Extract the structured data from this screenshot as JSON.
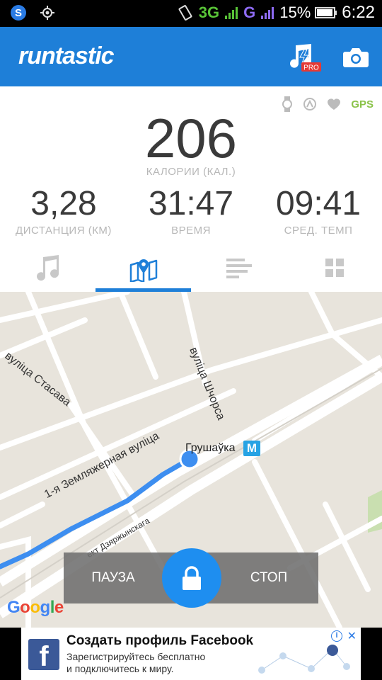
{
  "status_bar": {
    "network": "3G",
    "network_sup": "H",
    "network2": "G",
    "battery": "15%",
    "time": "6:22"
  },
  "app_bar": {
    "logo": "runtastic",
    "pro_badge": "PRO",
    "music_icon": "music-pro-icon",
    "camera_icon": "camera-icon"
  },
  "sensors": {
    "gps_label": "GPS"
  },
  "stats": {
    "calories_value": "206",
    "calories_label": "КАЛОРИИ (КАЛ.)",
    "distance_value": "3,28",
    "distance_label": "ДИСТАНЦИЯ (КМ)",
    "time_value": "31:47",
    "time_label": "ВРЕМЯ",
    "pace_value": "09:41",
    "pace_label": "СРЕД. ТЕМП"
  },
  "tabs": [
    {
      "icon": "music-note-icon",
      "active": false
    },
    {
      "icon": "map-icon",
      "active": true
    },
    {
      "icon": "bars-icon",
      "active": false
    },
    {
      "icon": "grid-icon",
      "active": false
    }
  ],
  "map": {
    "streets": [
      "вуліца Стасава",
      "вуліца Шчорса",
      "1-я Земляжерная вуліца",
      "ект Дзяржынскага"
    ],
    "metro_station": "Грушаўка",
    "metro_badge": "M",
    "attribution": "Google"
  },
  "controls": {
    "pause_label": "ПАУЗА",
    "stop_label": "СТОП",
    "lock_icon": "lock-icon"
  },
  "ad": {
    "title": "Создать профиль Facebook",
    "line1": "Зарегистрируйтесь бесплатно",
    "line2": "и подключитесь к миру.",
    "info": "i",
    "close": "✕"
  },
  "colors": {
    "accent": "#1e7fd8",
    "gps": "#8bc34a",
    "route": "#3d8ef0",
    "metro": "#27a3e4",
    "facebook": "#3b5998"
  }
}
